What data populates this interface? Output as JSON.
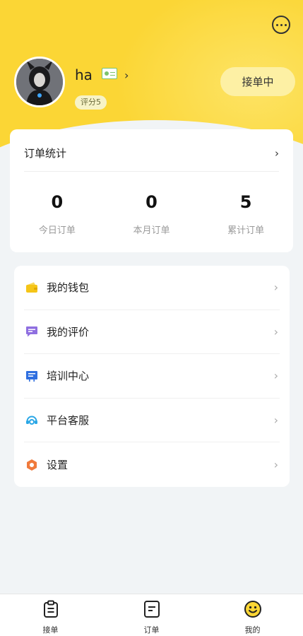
{
  "header": {
    "username": "ha",
    "rating": "评分5",
    "status_button": "接单中"
  },
  "stats": {
    "title": "订单统计",
    "items": [
      {
        "value": "0",
        "label": "今日订单"
      },
      {
        "value": "0",
        "label": "本月订单"
      },
      {
        "value": "5",
        "label": "累计订单"
      }
    ]
  },
  "menu": {
    "items": [
      {
        "label": "我的钱包",
        "icon": "wallet-icon"
      },
      {
        "label": "我的评价",
        "icon": "comment-icon"
      },
      {
        "label": "培训中心",
        "icon": "training-icon"
      },
      {
        "label": "平台客服",
        "icon": "customer-service-icon"
      },
      {
        "label": "设置",
        "icon": "settings-icon"
      }
    ]
  },
  "tabbar": {
    "items": [
      {
        "label": "接单",
        "icon": "clipboard-icon"
      },
      {
        "label": "订单",
        "icon": "order-list-icon"
      },
      {
        "label": "我的",
        "icon": "smiley-icon",
        "active": true
      }
    ]
  },
  "colors": {
    "brand_yellow": "#fbd635",
    "status_button_bg": "#fdf0a4",
    "page_bg": "#f1f4f6"
  }
}
